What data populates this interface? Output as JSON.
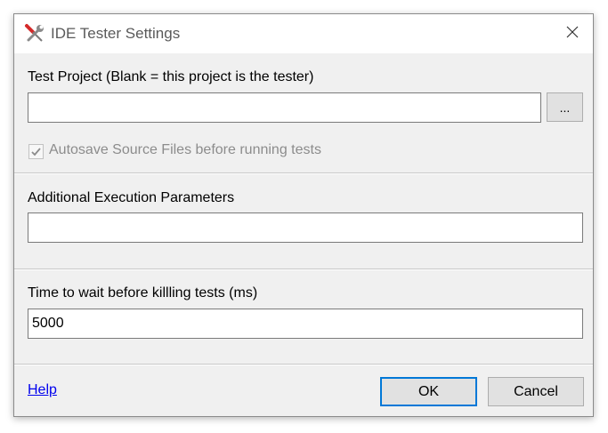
{
  "window": {
    "title": "IDE Tester Settings",
    "icon": "wrench-screwdriver-icon",
    "close_icon": "close-icon"
  },
  "test_project": {
    "label": "Test Project (Blank = this project is the tester)",
    "value": "",
    "browse_label": "..."
  },
  "autosave": {
    "label": "Autosave Source Files before running tests",
    "checked": true,
    "enabled": false
  },
  "execution_params": {
    "label": "Additional Execution Parameters",
    "value": ""
  },
  "wait_time": {
    "label": "Time to wait before killling tests (ms)",
    "value": "5000"
  },
  "footer": {
    "help_label": "Help",
    "ok_label": "OK",
    "cancel_label": "Cancel"
  },
  "colors": {
    "accent": "#0078d7",
    "link": "#0000ee",
    "dialog_bg": "#f0f0f0"
  }
}
